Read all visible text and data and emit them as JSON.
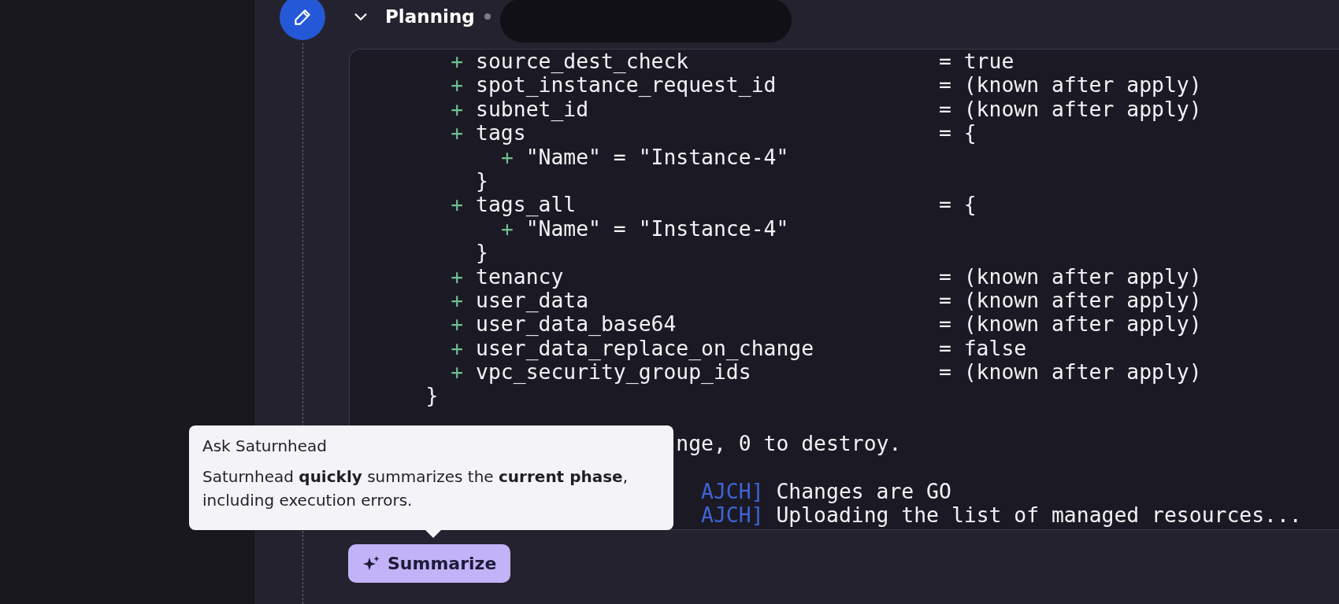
{
  "step": {
    "title": "Planning",
    "expanded": true
  },
  "log": {
    "lines": [
      {
        "kind": "attr",
        "marker": "+",
        "key": "source_dest_check",
        "value": "= true"
      },
      {
        "kind": "attr",
        "marker": "+",
        "key": "spot_instance_request_id",
        "value": "= (known after apply)"
      },
      {
        "kind": "attr",
        "marker": "+",
        "key": "subnet_id",
        "value": "= (known after apply)"
      },
      {
        "kind": "attr",
        "marker": "+",
        "key": "tags",
        "value": "= {"
      },
      {
        "kind": "nested",
        "marker": "+",
        "text": "\"Name\" = \"Instance-4\""
      },
      {
        "kind": "close_inner",
        "text": "}"
      },
      {
        "kind": "attr",
        "marker": "+",
        "key": "tags_all",
        "value": "= {"
      },
      {
        "kind": "nested",
        "marker": "+",
        "text": "\"Name\" = \"Instance-4\""
      },
      {
        "kind": "close_inner",
        "text": "}"
      },
      {
        "kind": "attr",
        "marker": "+",
        "key": "tenancy",
        "value": "= (known after apply)"
      },
      {
        "kind": "attr",
        "marker": "+",
        "key": "user_data",
        "value": "= (known after apply)"
      },
      {
        "kind": "attr",
        "marker": "+",
        "key": "user_data_base64",
        "value": "= (known after apply)"
      },
      {
        "kind": "attr",
        "marker": "+",
        "key": "user_data_replace_on_change",
        "value": "= false"
      },
      {
        "kind": "attr",
        "marker": "+",
        "key": "vpc_security_group_ids",
        "value": "= (known after apply)"
      },
      {
        "kind": "close_block",
        "text": "}"
      },
      {
        "kind": "blank"
      },
      {
        "kind": "summary",
        "text": "nge, 0 to destroy."
      },
      {
        "kind": "blank"
      },
      {
        "kind": "log",
        "tag": "AJCH]",
        "text": "Changes are GO"
      },
      {
        "kind": "log",
        "tag": "AJCH]",
        "text": "Uploading the list of managed resources..."
      }
    ]
  },
  "tooltip": {
    "title": "Ask Saturnhead",
    "text": "Saturnhead **quickly** summarizes the **current phase**, including execution errors."
  },
  "summarize_button": {
    "label": "Summarize"
  }
}
